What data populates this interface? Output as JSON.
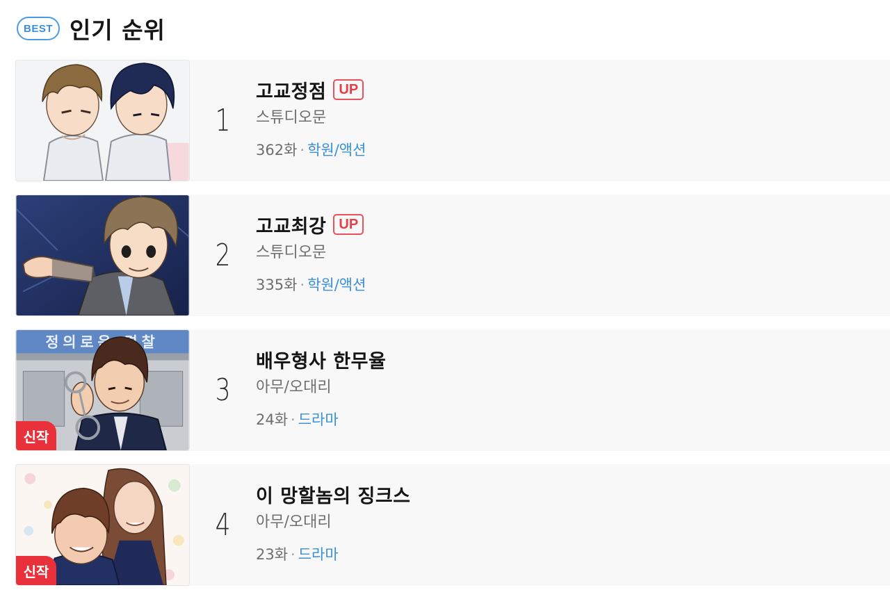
{
  "header": {
    "badge": "BEST",
    "title": "인기 순위"
  },
  "items": [
    {
      "rank": "1",
      "title": "고교정점",
      "up": "UP",
      "author": "스튜디오문",
      "episodes": "362화",
      "separator": "·",
      "genre": "학원/액션",
      "new": ""
    },
    {
      "rank": "2",
      "title": "고교최강",
      "up": "UP",
      "author": "스튜디오문",
      "episodes": "335화",
      "separator": "·",
      "genre": "학원/액션",
      "new": ""
    },
    {
      "rank": "3",
      "title": "배우형사 한무율",
      "up": "",
      "author": "아무/오대리",
      "episodes": "24화",
      "separator": "·",
      "genre": "드라마",
      "new": "신작",
      "thumb_sign": "정의로운 경찰"
    },
    {
      "rank": "4",
      "title": "이 망할놈의 징크스",
      "up": "",
      "author": "아무/오대리",
      "episodes": "23화",
      "separator": "·",
      "genre": "드라마",
      "new": "신작"
    }
  ],
  "colors": {
    "accent_blue": "#3a8fd9",
    "up_red": "#e23f48",
    "new_badge_red": "#e8313b",
    "row_background": "#f8f8f8"
  }
}
